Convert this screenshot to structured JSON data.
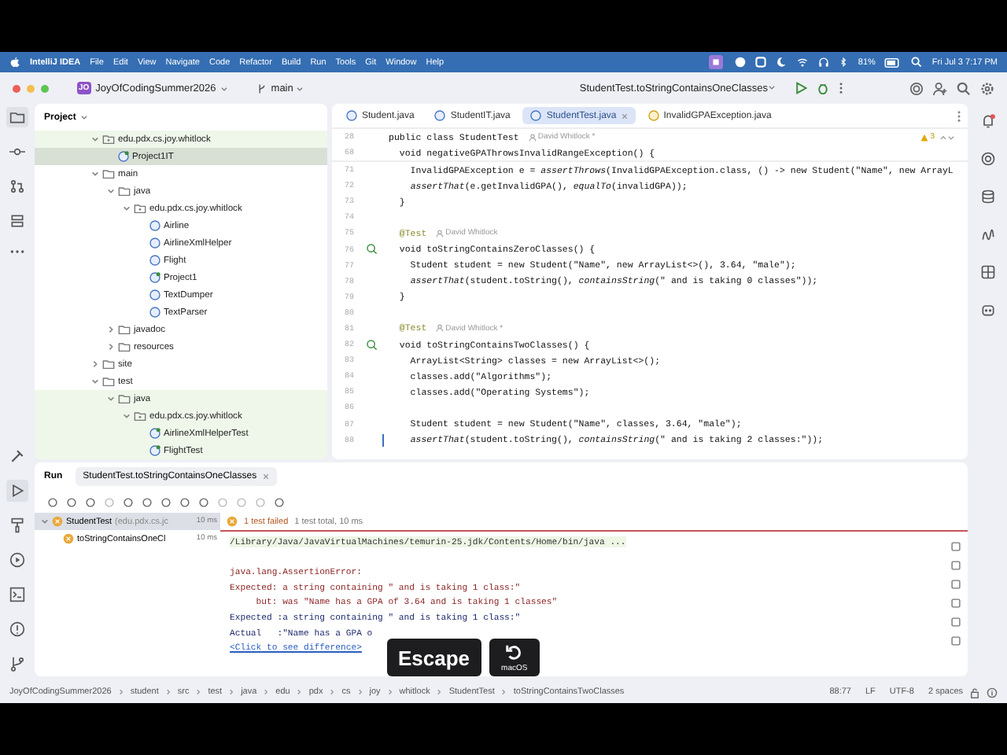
{
  "menubar": {
    "app": "IntelliJ IDEA",
    "menus": [
      "File",
      "Edit",
      "View",
      "Navigate",
      "Code",
      "Refactor",
      "Build",
      "Run",
      "Tools",
      "Git",
      "Window",
      "Help"
    ],
    "battery": "81%",
    "clock": "Fri Jul 3  7:17 PM"
  },
  "toolbar": {
    "project_badge": "JO",
    "project": "JoyOfCodingSummer2026",
    "branch": "main",
    "run_config": "StudentTest.toStringContainsOneClasses"
  },
  "project_panel": {
    "title": "Project",
    "tree": [
      {
        "label": "edu.pdx.cs.joy.whitlock",
        "kind": "package",
        "expanded": true,
        "selected": false,
        "highlighted": true,
        "children": [
          {
            "label": "Project1IT",
            "kind": "test_class",
            "selected": true,
            "highlighted": true
          }
        ]
      },
      {
        "label": "main",
        "kind": "folder",
        "expanded": true,
        "selected": false,
        "highlighted": false,
        "children": [
          {
            "label": "java",
            "kind": "folder",
            "expanded": true,
            "selected": false,
            "highlighted": false,
            "children": [
              {
                "label": "edu.pdx.cs.joy.whitlock",
                "kind": "package",
                "expanded": true,
                "selected": false,
                "highlighted": false,
                "children": [
                  {
                    "label": "Airline",
                    "kind": "class",
                    "selected": false,
                    "highlighted": false
                  },
                  {
                    "label": "AirlineXmlHelper",
                    "kind": "class",
                    "selected": false,
                    "highlighted": false
                  },
                  {
                    "label": "Flight",
                    "kind": "class",
                    "selected": false,
                    "highlighted": false
                  },
                  {
                    "label": "Project1",
                    "kind": "main_class",
                    "selected": false,
                    "highlighted": false
                  },
                  {
                    "label": "TextDumper",
                    "kind": "class",
                    "selected": false,
                    "highlighted": false
                  },
                  {
                    "label": "TextParser",
                    "kind": "class",
                    "selected": false,
                    "highlighted": false
                  }
                ]
              }
            ]
          },
          {
            "label": "javadoc",
            "kind": "folder",
            "expanded": false,
            "selected": false,
            "highlighted": false
          },
          {
            "label": "resources",
            "kind": "folder",
            "expanded": false,
            "selected": false,
            "highlighted": false
          }
        ]
      },
      {
        "label": "site",
        "kind": "folder",
        "expanded": false,
        "selected": false,
        "highlighted": false
      },
      {
        "label": "test",
        "kind": "folder",
        "expanded": true,
        "selected": false,
        "highlighted": false,
        "children": [
          {
            "label": "java",
            "kind": "folder",
            "expanded": true,
            "selected": false,
            "highlighted": true,
            "children": [
              {
                "label": "edu.pdx.cs.joy.whitlock",
                "kind": "package",
                "expanded": true,
                "selected": false,
                "highlighted": true,
                "children": [
                  {
                    "label": "AirlineXmlHelperTest",
                    "kind": "test_class",
                    "selected": false,
                    "highlighted": true
                  },
                  {
                    "label": "FlightTest",
                    "kind": "test_class",
                    "selected": false,
                    "highlighted": true
                  }
                ]
              }
            ]
          }
        ]
      }
    ]
  },
  "editor": {
    "tabs": [
      {
        "label": "Student.java",
        "kind": "class",
        "selected": false,
        "closable": false
      },
      {
        "label": "StudentIT.java",
        "kind": "test_class",
        "selected": false,
        "closable": false
      },
      {
        "label": "StudentTest.java",
        "kind": "test_class",
        "selected": true,
        "closable": true
      },
      {
        "label": "InvalidGPAException.java",
        "kind": "exception",
        "selected": false,
        "closable": false
      }
    ],
    "warnings": "3",
    "sticky_lines": [
      {
        "number": "28",
        "text": "public class StudentTest",
        "author": "David Whitlock *"
      },
      {
        "number": "68",
        "text": "  void negativeGPAThrowsInvalidRangeException() {"
      }
    ],
    "lines": [
      {
        "number": "71",
        "text": "    InvalidGPAException e = *assertThrows*(InvalidGPAException.class, () -> new Student(\"Name\", new ArrayL",
        "run_icon": false,
        "caret": false
      },
      {
        "number": "72",
        "text": "    *assertThat*(e.getInvalidGPA(), *equalTo*(invalidGPA));",
        "run_icon": false,
        "caret": false
      },
      {
        "number": "73",
        "text": "  }",
        "run_icon": false,
        "caret": false
      },
      {
        "number": "74",
        "run_icon": false,
        "caret": false
      },
      {
        "number": "75",
        "text": "  @Test",
        "author": "David Whitlock",
        "run_icon": false,
        "caret": false
      },
      {
        "number": "76",
        "text": "  void toStringContainsZeroClasses() {",
        "run_icon": true,
        "caret": false
      },
      {
        "number": "77",
        "text": "    Student student = new Student(\"Name\", new ArrayList<>(), 3.64, \"male\");",
        "run_icon": false,
        "caret": false
      },
      {
        "number": "78",
        "text": "    *assertThat*(student.toString(), *containsString*(\" and is taking 0 classes\"));",
        "run_icon": false,
        "caret": false
      },
      {
        "number": "79",
        "text": "  }",
        "run_icon": false,
        "caret": false
      },
      {
        "number": "80",
        "run_icon": false,
        "caret": false
      },
      {
        "number": "81",
        "text": "  @Test",
        "author": "David Whitlock *",
        "run_icon": false,
        "caret": false
      },
      {
        "number": "82",
        "text": "  void toStringContainsTwoClasses() {",
        "run_icon": true,
        "caret": false
      },
      {
        "number": "83",
        "text": "    ArrayList<String> classes = new ArrayList<>();",
        "run_icon": false,
        "caret": false
      },
      {
        "number": "84",
        "text": "    classes.add(\"Algorithms\");",
        "run_icon": false,
        "caret": false
      },
      {
        "number": "85",
        "text": "    classes.add(\"Operating Systems\");",
        "run_icon": false,
        "caret": false
      },
      {
        "number": "86",
        "run_icon": false,
        "caret": false
      },
      {
        "number": "87",
        "text": "    Student student = new Student(\"Name\", classes, 3.64, \"male\");",
        "run_icon": false,
        "caret": false
      },
      {
        "number": "88",
        "text": "    *assertThat*(student.toString(), *containsString*(\" and is taking 2 classes:\"));",
        "run_icon": false,
        "caret": true
      }
    ]
  },
  "run_panel": {
    "title": "Run",
    "tab": "StudentTest.toStringContainsOneClasses",
    "tests": [
      {
        "label": "StudentTest",
        "detail": "(edu.pdx.cs.jc",
        "time": "10 ms",
        "selected": true,
        "children": [
          {
            "label": "toStringContainsOneCl",
            "time": "10 ms",
            "selected": false
          }
        ]
      }
    ],
    "summary_failed": "1 test failed",
    "summary_total": "1 test total, 10 ms",
    "console": [
      {
        "kind": "command",
        "text": "/Library/Java/JavaVirtualMachines/temurin-25.jdk/Contents/Home/bin/java ..."
      },
      {
        "kind": "blank"
      },
      {
        "kind": "error",
        "text": "java.lang.AssertionError:"
      },
      {
        "kind": "error",
        "text": "Expected: a string containing \" and is taking 1 class:\""
      },
      {
        "kind": "error",
        "text": "     but: was \"Name has a GPA of 3.64 and is taking 1 classes\""
      },
      {
        "kind": "info",
        "text": "Expected :a string containing \" and is taking 1 class:\""
      },
      {
        "kind": "info",
        "text": "Actual   :\"Name has a GPA o"
      },
      {
        "kind": "link",
        "text": "<Click to see difference>"
      }
    ]
  },
  "keystroke_overlay": [
    {
      "kind": "key",
      "label": "Escape"
    },
    {
      "kind": "icon_key",
      "label": "macOS"
    }
  ],
  "status_bar": {
    "breadcrumbs": [
      "JoyOfCodingSummer2026",
      "student",
      "src",
      "test",
      "java",
      "edu",
      "pdx",
      "cs",
      "joy",
      "whitlock",
      "StudentTest",
      "toStringContainsTwoClasses"
    ],
    "position": "88:77",
    "line_ending": "LF",
    "encoding": "UTF-8",
    "indent": "2 spaces"
  }
}
